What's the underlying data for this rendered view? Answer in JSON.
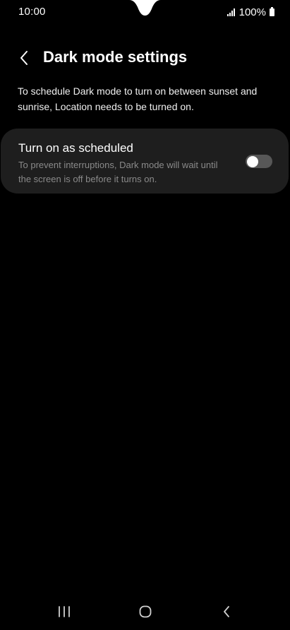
{
  "status_bar": {
    "time": "10:00",
    "battery": "100%",
    "icons": [
      "signal-icon",
      "battery-icon"
    ]
  },
  "header": {
    "title": "Dark mode settings",
    "back_icon": "chevron-left-icon"
  },
  "description": "To schedule Dark mode to turn on between sunset and sunrise, Location needs to be turned on.",
  "setting": {
    "title": "Turn on as scheduled",
    "subtitle": "To prevent interruptions, Dark mode will wait until the screen is off before it turns on.",
    "toggle_on": false
  },
  "nav_bar": {
    "buttons": [
      "recent-apps-icon",
      "home-icon",
      "back-icon"
    ]
  },
  "colors": {
    "background": "#000000",
    "card": "#1e1e1e",
    "subtitle_text": "#8a8a8a",
    "toggle_off_track": "#575757"
  }
}
